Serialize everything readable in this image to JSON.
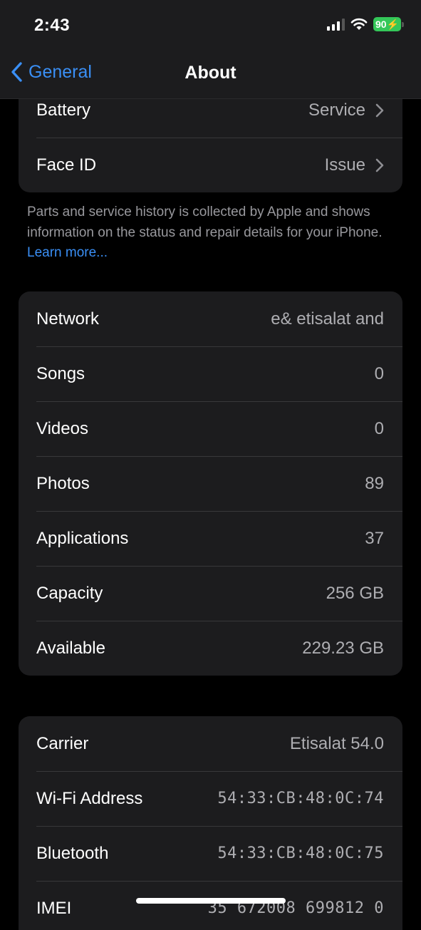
{
  "status_bar": {
    "time": "2:43",
    "battery_percent": "90",
    "charging": true
  },
  "nav": {
    "back_label": "General",
    "title": "About"
  },
  "group_service": [
    {
      "label": "Battery",
      "value": "Service"
    },
    {
      "label": "Face ID",
      "value": "Issue"
    }
  ],
  "footnote": {
    "text": "Parts and service history is collected by Apple and shows information on the status and repair details for your iPhone. ",
    "link": "Learn more..."
  },
  "group_info": [
    {
      "label": "Network",
      "value": "e& etisalat and"
    },
    {
      "label": "Songs",
      "value": "0"
    },
    {
      "label": "Videos",
      "value": "0"
    },
    {
      "label": "Photos",
      "value": "89"
    },
    {
      "label": "Applications",
      "value": "37"
    },
    {
      "label": "Capacity",
      "value": "256 GB"
    },
    {
      "label": "Available",
      "value": "229.23 GB"
    }
  ],
  "group_network": [
    {
      "label": "Carrier",
      "value": "Etisalat 54.0"
    },
    {
      "label": "Wi-Fi Address",
      "value": "54:33:CB:48:0C:74"
    },
    {
      "label": "Bluetooth",
      "value": "54:33:CB:48:0C:75"
    },
    {
      "label": "IMEI",
      "value": "35 672008 699812 0"
    }
  ],
  "colors": {
    "accent": "#3a8ff5",
    "battery": "#34c759",
    "cell_bg": "#1c1c1e"
  }
}
